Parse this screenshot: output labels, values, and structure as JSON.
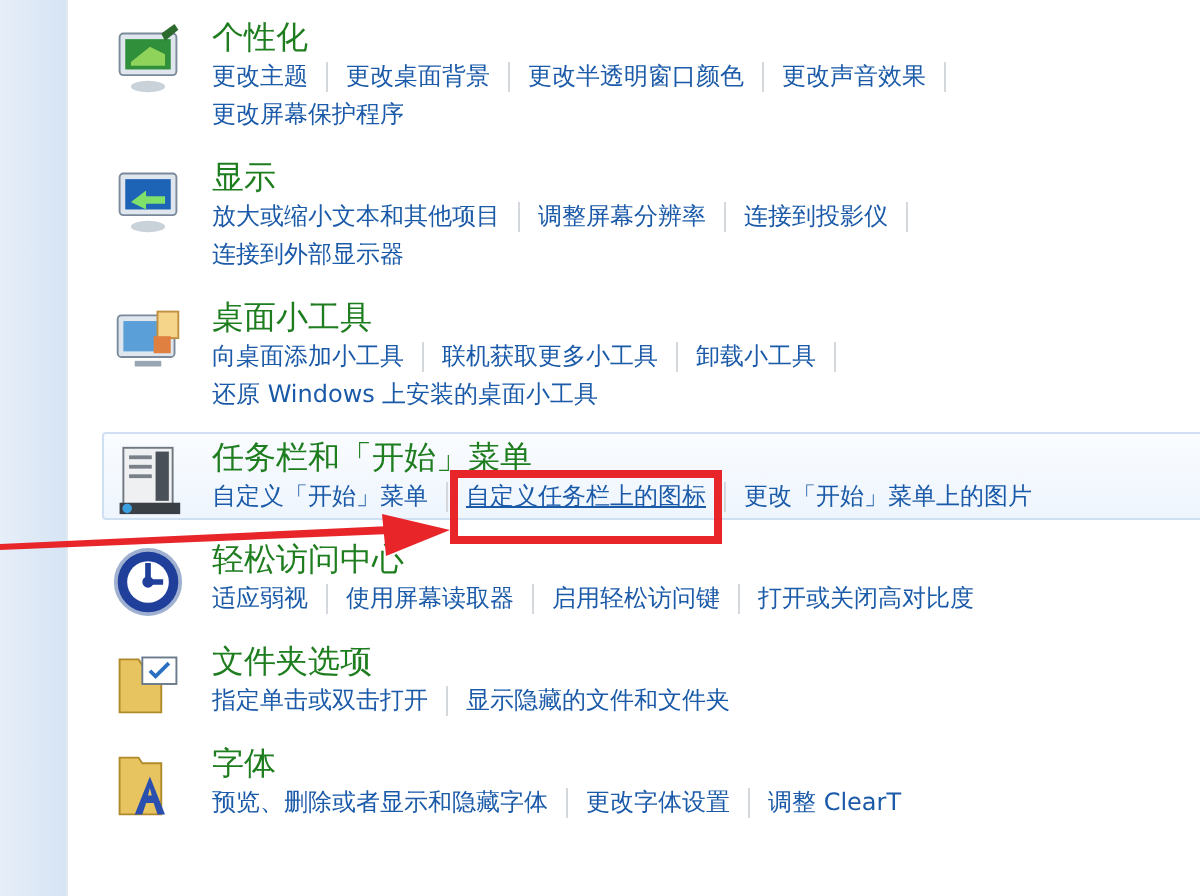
{
  "categories": [
    {
      "title": "个性化",
      "hovered": false,
      "link_rows": [
        [
          {
            "text": "更改主题"
          },
          {
            "text": "更改桌面背景"
          },
          {
            "text": "更改半透明窗口颜色"
          },
          {
            "text": "更改声音效果"
          }
        ],
        [
          {
            "text": "更改屏幕保护程序",
            "last": true
          }
        ]
      ]
    },
    {
      "title": "显示",
      "hovered": false,
      "link_rows": [
        [
          {
            "text": "放大或缩小文本和其他项目"
          },
          {
            "text": "调整屏幕分辨率"
          },
          {
            "text": "连接到投影仪"
          }
        ],
        [
          {
            "text": "连接到外部显示器",
            "last": true
          }
        ]
      ]
    },
    {
      "title": "桌面小工具",
      "hovered": false,
      "link_rows": [
        [
          {
            "text": "向桌面添加小工具"
          },
          {
            "text": "联机获取更多小工具"
          },
          {
            "text": "卸载小工具"
          }
        ],
        [
          {
            "text": "还原 Windows 上安装的桌面小工具",
            "last": true
          }
        ]
      ]
    },
    {
      "title": "任务栏和「开始」菜单",
      "hovered": true,
      "link_rows": [
        [
          {
            "text": "自定义「开始」菜单"
          },
          {
            "text": "自定义任务栏上的图标",
            "underlined": true,
            "annotated": true
          },
          {
            "text": "更改「开始」菜单上的图片",
            "last": true
          }
        ]
      ]
    },
    {
      "title": "轻松访问中心",
      "hovered": false,
      "link_rows": [
        [
          {
            "text": "适应弱视"
          },
          {
            "text": "使用屏幕读取器"
          },
          {
            "text": "启用轻松访问键"
          },
          {
            "text": "打开或关闭高对比度",
            "last": true
          }
        ]
      ]
    },
    {
      "title": "文件夹选项",
      "hovered": false,
      "link_rows": [
        [
          {
            "text": "指定单击或双击打开"
          },
          {
            "text": "显示隐藏的文件和文件夹",
            "last": true
          }
        ]
      ]
    },
    {
      "title": "字体",
      "hovered": false,
      "link_rows": [
        [
          {
            "text": "预览、删除或者显示和隐藏字体"
          },
          {
            "text": "更改字体设置"
          },
          {
            "text": "调整 ClearT",
            "last": true
          }
        ]
      ]
    }
  ]
}
